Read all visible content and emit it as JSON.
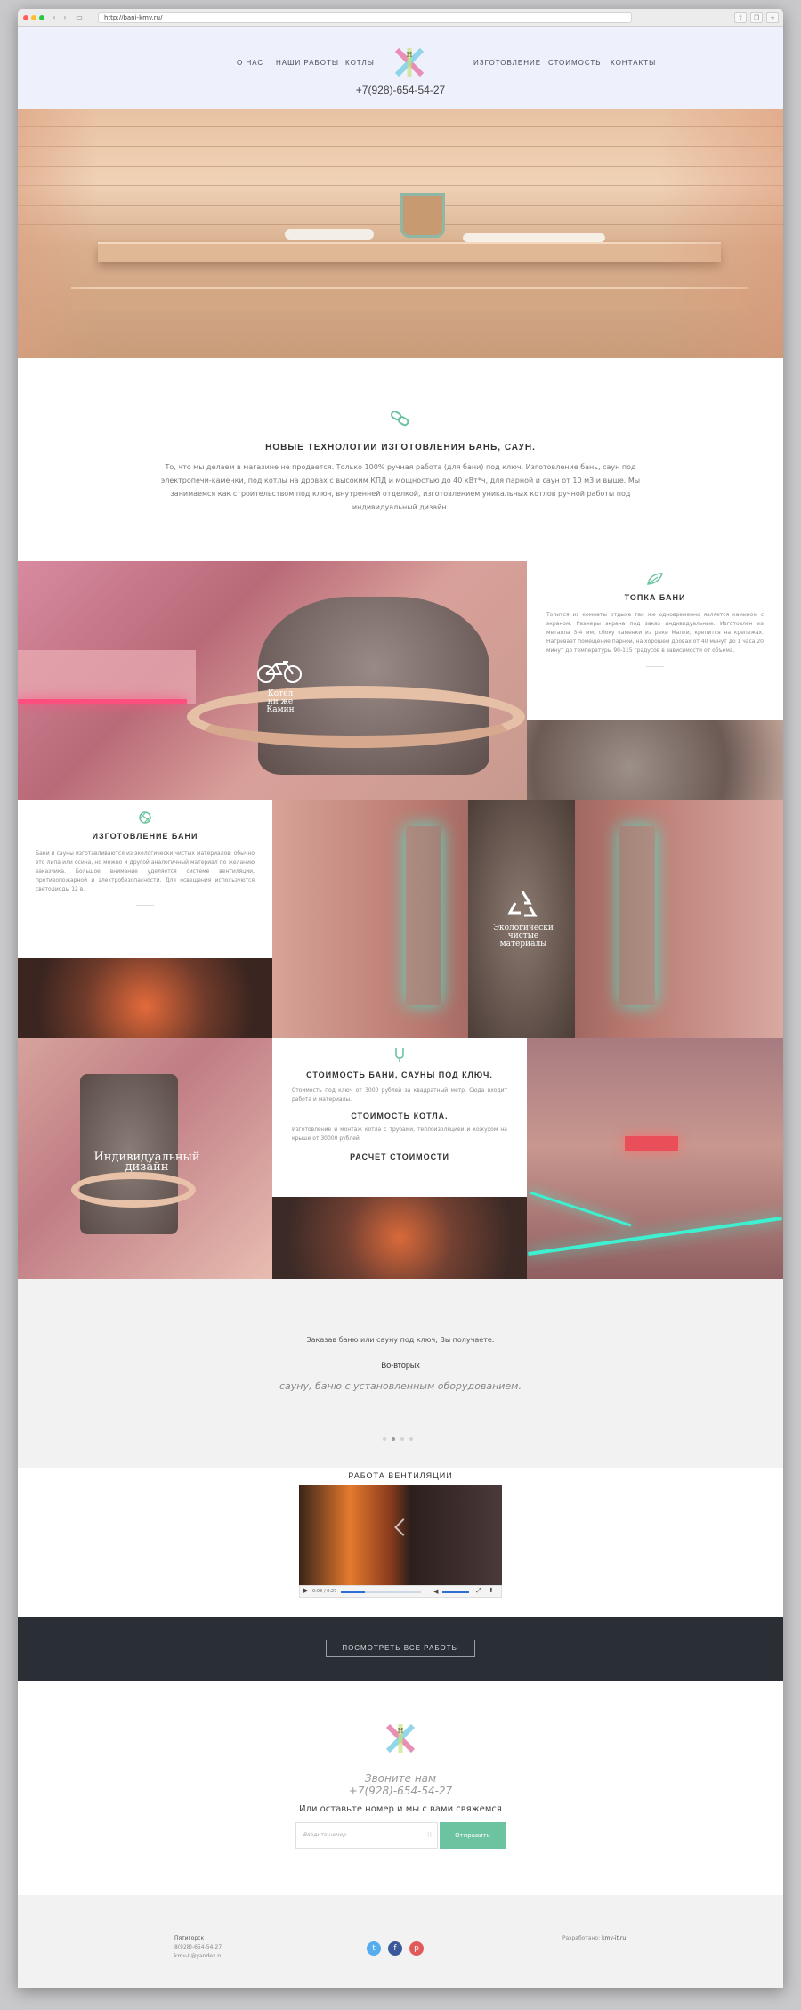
{
  "browser": {
    "url": "http://bani-kmv.ru/",
    "dots": [
      "#ff5f57",
      "#ffbd2e",
      "#28c940"
    ]
  },
  "nav": {
    "items": [
      "О НАС",
      "НАШИ РАБОТЫ",
      "КОТЛЫ",
      "ИЗГОТОВЛЕНИЕ",
      "СТОИМОСТЬ",
      "КОНТАКТЫ"
    ],
    "phone": "+7(928)-654-54-27",
    "logo_letters": "Н"
  },
  "intro": {
    "icon": "link-icon",
    "title": "НОВЫЕ ТЕХНОЛОГИИ ИЗГОТОВЛЕНИЯ БАНЬ, САУН.",
    "text": "То, что мы делаем в магазине не продается. Только 100% ручная работа (для бани) под ключ. Изготовление бань, саун под электропечи-каменки, под котлы на дровах с высоким КПД и мощностью до 40 кВт*ч, для парной и саун от 10 м3 и выше. Мы занимаемся как строительством под ключ, внутренней отделкой, изготовлением уникальных котлов ручной работы под индивидуальный дизайн."
  },
  "features": {
    "topka": {
      "icon": "leaf-icon",
      "title": "ТОПКА БАНИ",
      "text": "Топится из комнаты отдыха так же одновременно является камином с экраном. Размеры экрана под заказ индивидуальные. Изготовлен из металла 3-4 мм, сбоку каменки из реки Малки, крепится на крепежах. Нагревает помещение парной, на хорошем дровах от 40 минут до 1 часа 20 минут до температуры 90-115 градусов в зависимости от объема."
    },
    "kotel_label": "Котел\nни же\nКамин",
    "izgotovlenie": {
      "icon": "ball-icon",
      "title": "ИЗГОТОВЛЕНИЕ БАНИ",
      "text": "Бани и сауны изготавливаются из экологически чистых материалов, обычно это липа или осина, но можно и другой аналогичный материал по желанию заказчика. Большое внимание уделяется системе вентиляции, противопожарной и электробезопасности. Для освещения используются светодиоды 12 в."
    },
    "eco_label": "Экологически\nчистые\nматериалы",
    "cost": {
      "icon": "fork-icon",
      "title": "СТОИМОСТЬ БАНИ, САУНЫ ПОД КЛЮЧ.",
      "text1": "Стоимость под ключ от 3000 рублей за квадратный метр. Сюда входит работа и материалы.",
      "subtitle": "СТОИМОСТЬ КОТЛА.",
      "text2": "Изготовление и монтаж котла с трубами, теплоизоляцией и кожухом на крыше от 30000 рублей.",
      "calc": "РАСЧЕТ СТОИМОСТИ"
    },
    "design_label": "Индивидуальный\nдизайн"
  },
  "slider": {
    "lead": "Заказав баню или сауну под ключ, Вы получаете:",
    "heading": "Во-вторых",
    "quote": "сауну, баню с установленным оборудованием.",
    "active_dot": 1
  },
  "video": {
    "title": "РАБОТА ВЕНТИЛЯЦИИ",
    "time": "0:08 / 0:27",
    "progress": 0.3
  },
  "works_button": "ПОСМОТРЕТЬ ВСЕ РАБОТЫ",
  "contact": {
    "call_label": "Звоните нам",
    "phone": "+7(928)-654-54-27",
    "prompt": "Или оставьте номер и мы с вами свяжемся",
    "input_placeholder": "Введите номер",
    "send": "Отправить",
    "accent": "#6cc3a0"
  },
  "footer": {
    "city": "Пятигорск",
    "phone": "8(928)-654-54-27",
    "email": "kmv-II@yandex.ru",
    "dev_label": "Разработано:",
    "dev_name": "kmv-it.ru",
    "socials": [
      {
        "name": "twitter-icon",
        "glyph": "t",
        "color": "#55acee"
      },
      {
        "name": "facebook-icon",
        "glyph": "f",
        "color": "#3b5998"
      },
      {
        "name": "pinterest-icon",
        "glyph": "p",
        "color": "#e05a5a"
      }
    ]
  }
}
